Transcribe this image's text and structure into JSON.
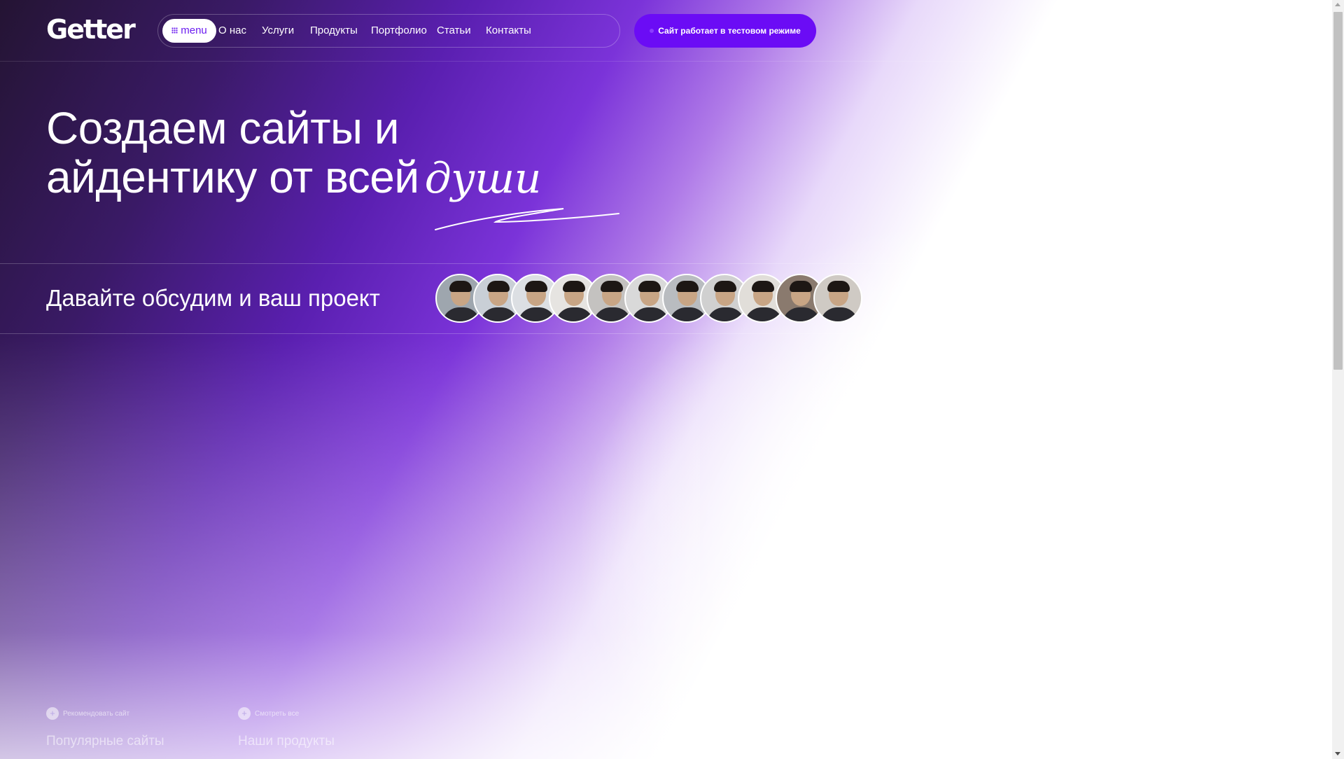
{
  "header": {
    "logo": "Getter",
    "menu_button": "menu",
    "nav": [
      {
        "label": "О нас"
      },
      {
        "label": "Услуги"
      },
      {
        "label": "Продукты"
      },
      {
        "label": "Портфолио"
      },
      {
        "label": "Статьи"
      },
      {
        "label": "Контакты"
      }
    ],
    "cta": "Сайт работает в тестовом режиме"
  },
  "hero": {
    "title_line1": "Создаем сайты и",
    "title_line2": "айдентику от всей",
    "title_accent": "души"
  },
  "discuss": {
    "text": "Давайте обсудим и ваш проект",
    "avatar_count": 11,
    "avatars": [
      {
        "bg": "#9ea6ae"
      },
      {
        "bg": "#c9cfd6"
      },
      {
        "bg": "#dcdfe3"
      },
      {
        "bg": "#e6e4e1"
      },
      {
        "bg": "#c4c2c0"
      },
      {
        "bg": "#d9d9d9"
      },
      {
        "bg": "#b9bcc0"
      },
      {
        "bg": "#d0d0d0"
      },
      {
        "bg": "#e1ded9"
      },
      {
        "bg": "#8a7a6e"
      },
      {
        "bg": "#cfcac4"
      }
    ]
  },
  "bottom_tabs": [
    {
      "small": "Рекомендовать сайт",
      "big": "Популярные сайты"
    },
    {
      "small": "Смотреть все",
      "big": "Наши продукты"
    }
  ],
  "colors": {
    "accent": "#6b0cf5",
    "dark": "#241433"
  }
}
